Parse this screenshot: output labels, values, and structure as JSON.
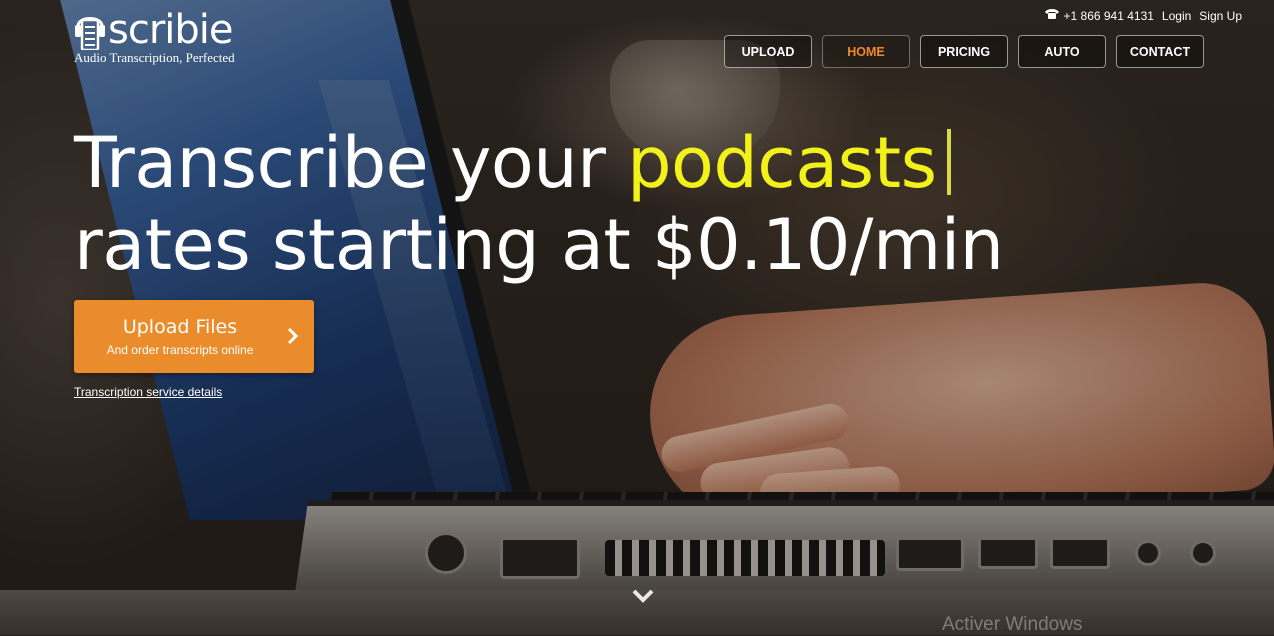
{
  "logo": {
    "word": "scribie",
    "tagline": "Audio Transcription, Perfected"
  },
  "topbar": {
    "phone": "+1 866 941 4131",
    "login": "Login",
    "signup": "Sign Up"
  },
  "nav": [
    {
      "label": "UPLOAD"
    },
    {
      "label": "HOME"
    },
    {
      "label": "PRICING"
    },
    {
      "label": "AUTO"
    },
    {
      "label": "CONTACT"
    }
  ],
  "hero": {
    "line1_prefix": "Transcribe your ",
    "line1_highlight": "podcasts",
    "line2": "rates starting at $0.10/min"
  },
  "upload": {
    "title": "Upload Files",
    "subtitle": "And order transcripts online"
  },
  "details_link": "Transcription service details",
  "watermark": "Activer Windows",
  "colors": {
    "accent": "#ea8c2b",
    "highlight": "#f2f21a",
    "active_nav": "#f0882a"
  }
}
